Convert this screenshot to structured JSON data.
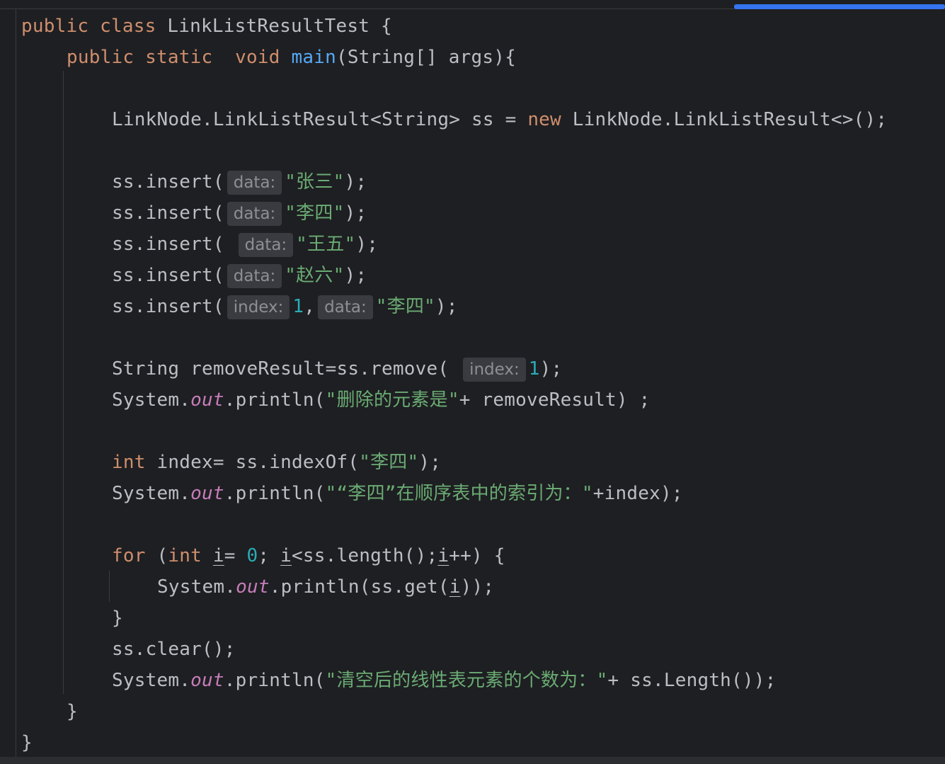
{
  "editor": {
    "colors": {
      "background": "#1e1f22",
      "keyword": "#cf8e6d",
      "method_declaration": "#56a8f5",
      "string": "#6aab73",
      "number": "#2aacb8",
      "static_field": "#c77dbb",
      "default_text": "#bcbec4",
      "inlay_hint_text": "#8c8f94",
      "inlay_hint_background": "#393b40",
      "progress_bar": "#3574f0"
    },
    "code": {
      "l1": {
        "kw1": "public",
        "kw2": "class",
        "name": "LinkListResultTest {"
      },
      "l2": {
        "kw1": "public",
        "kw2": "static",
        "kw3": "void",
        "method": "main",
        "params": "(String[] args){"
      },
      "l3": {
        "decl": "LinkNode.LinkListResult<String> ss = ",
        "kw": "new",
        "rest": " LinkNode.LinkListResult<>();"
      },
      "insert_call": "ss.insert(",
      "close_paren": ");",
      "hint_data": "data:",
      "hint_index": "index:",
      "comma": ",",
      "l4_arg": "\"张三\"",
      "l5_arg": "\"李四\"",
      "l6_arg": "\"王五\"",
      "l7_arg": "\"赵六\"",
      "l8_num": "1",
      "l8_arg": "\"李四\"",
      "l9": {
        "pre": "String removeResult=ss.remove(",
        "num": "1",
        "post": ");"
      },
      "system": "System.",
      "out": "out",
      "println": ".println(",
      "l10": {
        "str": "\"删除的元素是\"",
        "post": "+ removeResult) ;"
      },
      "l11": {
        "kw": "int",
        "rest": " index= ss.indexOf(",
        "str": "\"李四\"",
        "post": ");"
      },
      "l12": {
        "str": "\"“李四”在顺序表中的索引为：\"",
        "post": "+index);"
      },
      "l13": {
        "kw_for": "for",
        "open": " (",
        "kw_int": "int",
        "i": "i",
        "eq": "= ",
        "num": "0",
        "mid": "; ",
        "cond": "<ss.length();",
        "inc": "++) {"
      },
      "l14": {
        "post1": ".println(ss.get(",
        "post2": "));"
      },
      "close_brace": "}",
      "l16": "ss.clear();",
      "l17": {
        "str": "\"清空后的线性表元素的个数为：\"",
        "post": "+ ss.Length());"
      }
    }
  }
}
